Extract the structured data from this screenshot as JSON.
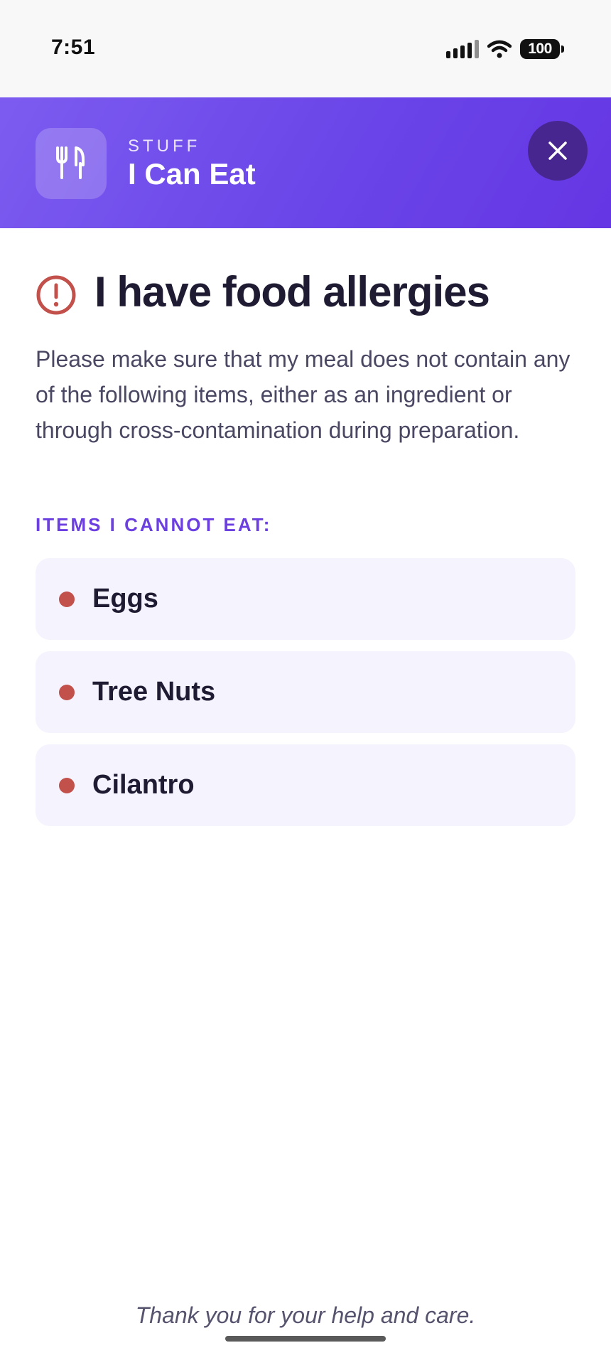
{
  "status_bar": {
    "time": "7:51",
    "battery": "100"
  },
  "header": {
    "app_label_small": "STUFF",
    "app_title": "I Can Eat",
    "logo_icon": "fork-knife-icon",
    "close_icon": "close-icon"
  },
  "main": {
    "title": "I have food allergies",
    "title_icon": "alert-circle-icon",
    "description": "Please make sure that my meal does not contain any of the following items, either as an ingredient or through cross-contamination during preparation.",
    "section_label": "ITEMS I CANNOT EAT:",
    "items": [
      {
        "label": "Eggs"
      },
      {
        "label": "Tree Nuts"
      },
      {
        "label": "Cilantro"
      }
    ]
  },
  "footer": {
    "message": "Thank you for your help and care."
  },
  "colors": {
    "accent": "#6c3fe0",
    "header_gradient_start": "#7c5cf0",
    "header_gradient_end": "#6536e4",
    "close_button": "#48268f",
    "alert": "#c2504b",
    "item_background": "#f5f3fd",
    "text_primary": "#1e1b33",
    "text_secondary": "#4a4763"
  }
}
